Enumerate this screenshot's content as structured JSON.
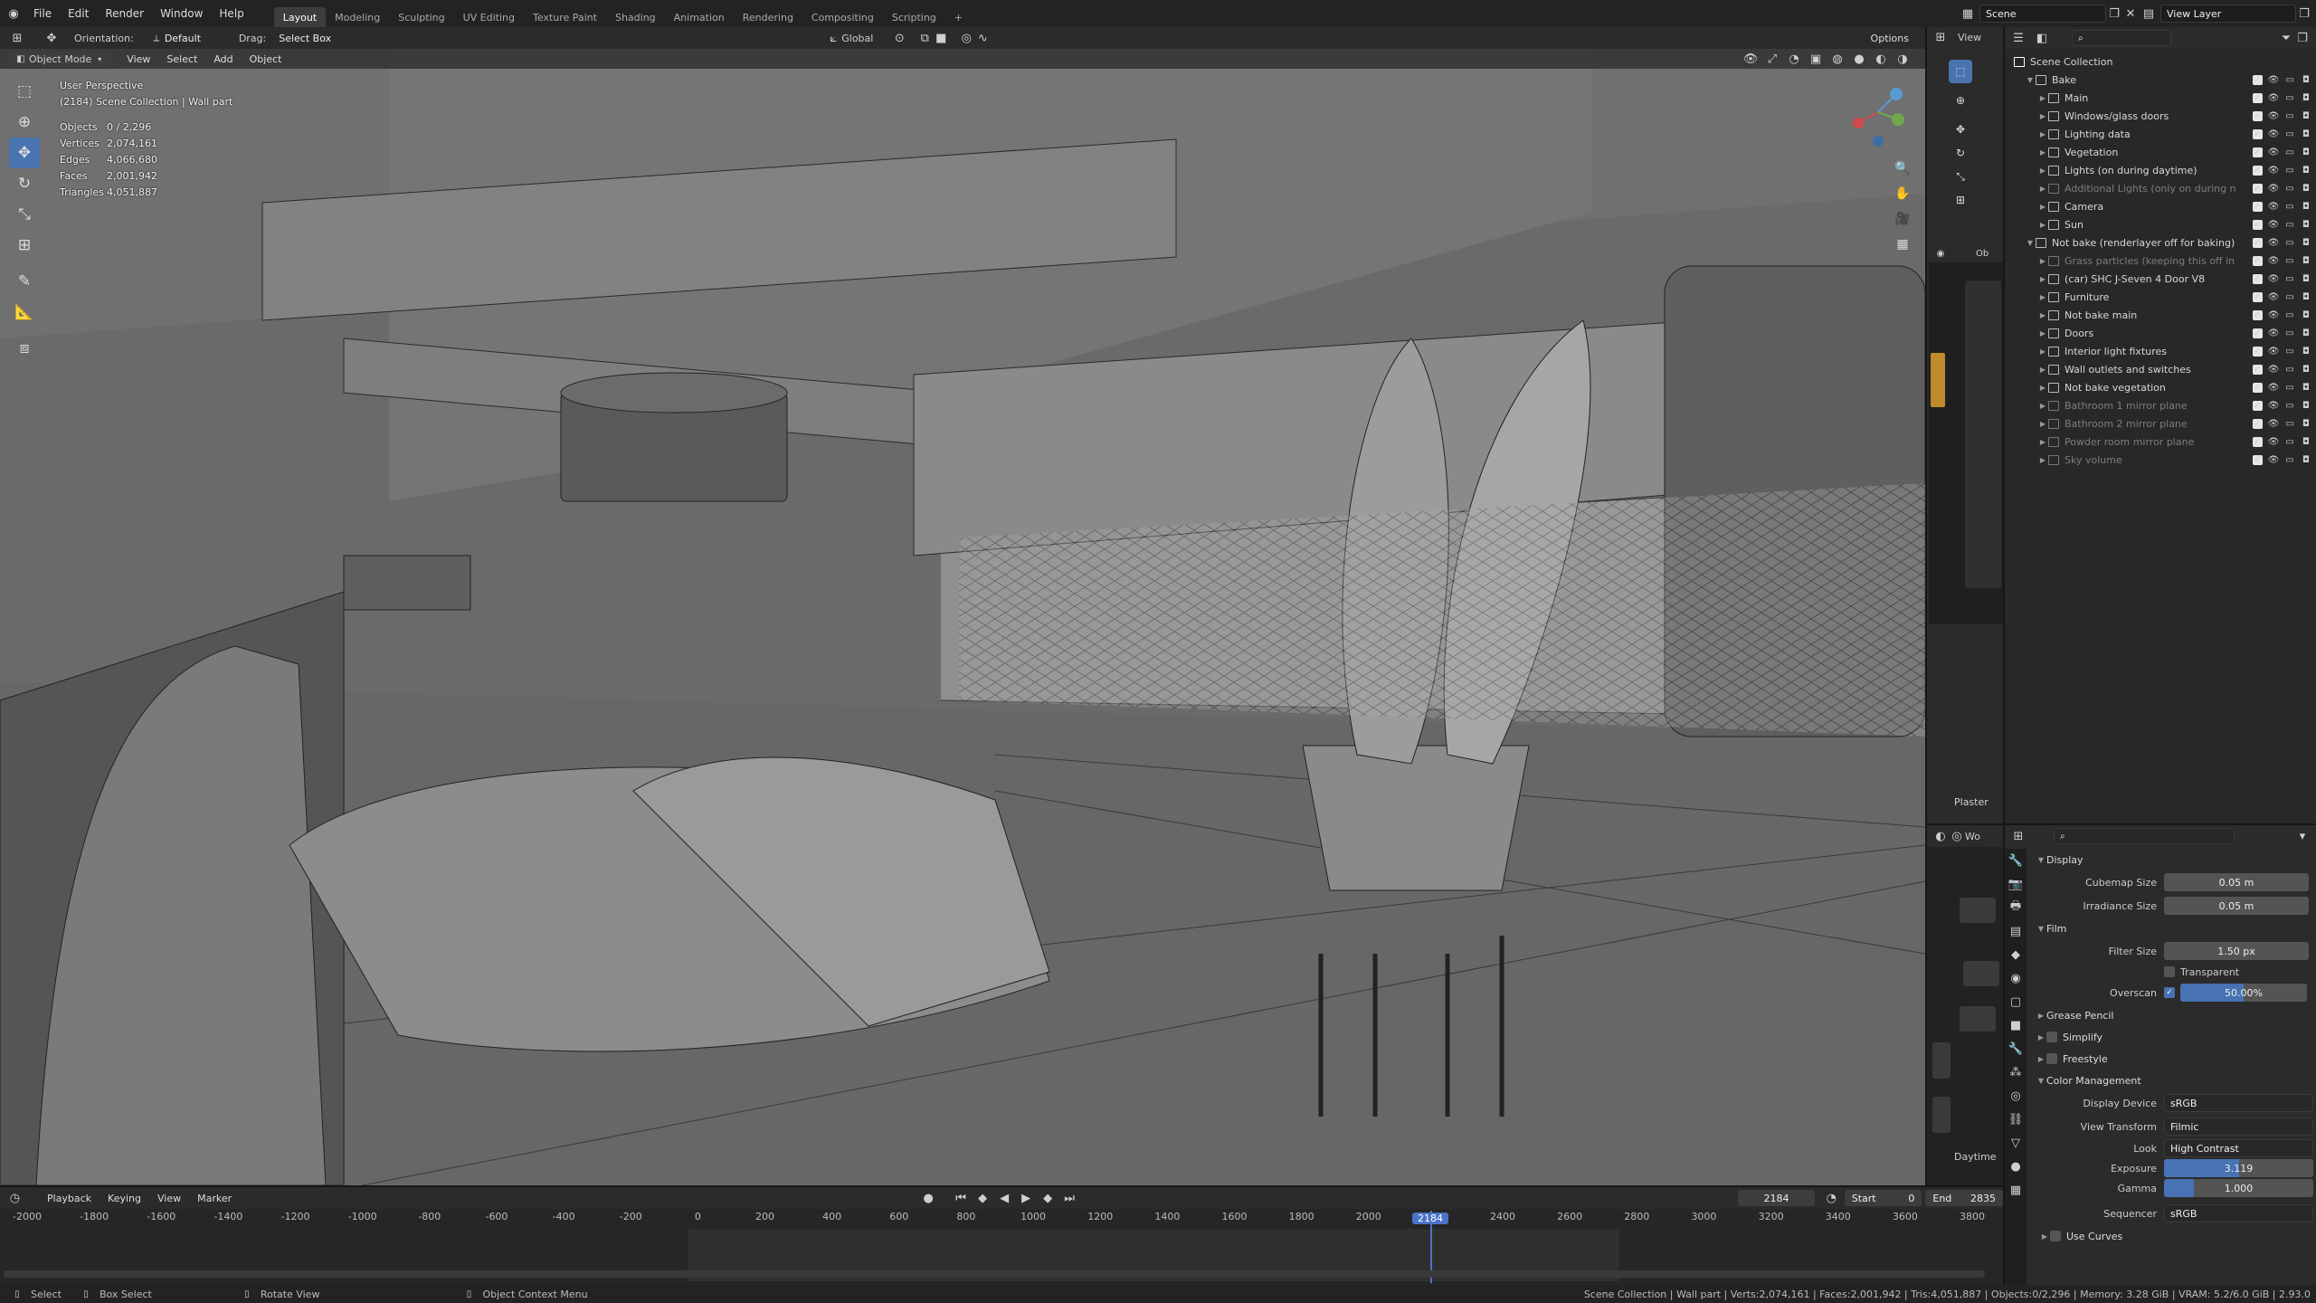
{
  "topbar": {
    "menus": [
      "File",
      "Edit",
      "Render",
      "Window",
      "Help"
    ],
    "workspaces": [
      "Layout",
      "Modeling",
      "Sculpting",
      "UV Editing",
      "Texture Paint",
      "Shading",
      "Animation",
      "Rendering",
      "Compositing",
      "Scripting"
    ],
    "active_workspace": "Layout",
    "add_tab": "+",
    "scene": "Scene",
    "view_layer": "View Layer"
  },
  "tool_settings": {
    "orientation_label": "Orientation:",
    "orientation_value": "Default",
    "drag_label": "Drag:",
    "drag_value": "Select Box",
    "transform_orientation": "Global",
    "options": "Options"
  },
  "viewport_header": {
    "mode": "Object Mode",
    "menus": [
      "View",
      "Select",
      "Add",
      "Object"
    ]
  },
  "viewport": {
    "perspective": "User Perspective",
    "collection_info": "(2184) Scene Collection | Wall part",
    "stats": [
      {
        "label": "Objects",
        "value": "0 / 2,296"
      },
      {
        "label": "Vertices",
        "value": "2,074,161"
      },
      {
        "label": "Edges",
        "value": "4,066,680"
      },
      {
        "label": "Faces",
        "value": "2,001,942"
      },
      {
        "label": "Triangles",
        "value": "4,051,887"
      }
    ]
  },
  "node_editor": {
    "view": "View",
    "material_label": "Plaster",
    "world_label": "Daytime",
    "hdr_tab": "Ob",
    "world_tab": "Wo"
  },
  "outliner": {
    "root": "Scene Collection",
    "rows": [
      {
        "name": "Bake",
        "level": 1,
        "expanded": true,
        "dim": false
      },
      {
        "name": "Main",
        "level": 2,
        "dim": false
      },
      {
        "name": "Windows/glass doors",
        "level": 2,
        "dim": false
      },
      {
        "name": "Lighting data",
        "level": 2,
        "dim": false
      },
      {
        "name": "Vegetation",
        "level": 2,
        "dim": false
      },
      {
        "name": "Lights (on during daytime)",
        "level": 2,
        "dim": false
      },
      {
        "name": "Additional Lights (only on during n",
        "level": 2,
        "dim": true
      },
      {
        "name": "Camera",
        "level": 2,
        "dim": false
      },
      {
        "name": "Sun",
        "level": 2,
        "dim": false
      },
      {
        "name": "Not bake (renderlayer off for baking)",
        "level": 1,
        "expanded": true,
        "dim": false
      },
      {
        "name": "Grass particles (keeping this off in",
        "level": 2,
        "dim": true
      },
      {
        "name": "(car) SHC J-Seven 4 Door V8",
        "level": 2,
        "dim": false
      },
      {
        "name": "Furniture",
        "level": 2,
        "dim": false
      },
      {
        "name": "Not bake main",
        "level": 2,
        "dim": false
      },
      {
        "name": "Doors",
        "level": 2,
        "dim": false
      },
      {
        "name": "Interior light fixtures",
        "level": 2,
        "dim": false
      },
      {
        "name": "Wall outlets and switches",
        "level": 2,
        "dim": false
      },
      {
        "name": "Not bake vegetation",
        "level": 2,
        "dim": false
      },
      {
        "name": "Bathroom 1 mirror plane",
        "level": 2,
        "dim": true
      },
      {
        "name": "Bathroom 2 mirror plane",
        "level": 2,
        "dim": true
      },
      {
        "name": "Powder room mirror plane",
        "level": 2,
        "dim": true
      },
      {
        "name": "Sky volume",
        "level": 2,
        "dim": true
      }
    ]
  },
  "properties": {
    "display_section": "Display",
    "cubemap_label": "Cubemap Size",
    "cubemap_value": "0.05 m",
    "irradiance_label": "Irradiance Size",
    "irradiance_value": "0.05 m",
    "film_section": "Film",
    "filter_label": "Filter Size",
    "filter_value": "1.50 px",
    "transparent_label": "Transparent",
    "overscan_label": "Overscan",
    "overscan_value": "50.00%",
    "overscan_fraction": 0.5,
    "grease_pencil": "Grease Pencil",
    "simplify": "Simplify",
    "freestyle": "Freestyle",
    "color_mgmt": "Color Management",
    "display_device_label": "Display Device",
    "display_device": "sRGB",
    "view_transform_label": "View Transform",
    "view_transform": "Filmic",
    "look_label": "Look",
    "look": "High Contrast",
    "exposure_label": "Exposure",
    "exposure": "3.119",
    "exposure_fraction": 0.5,
    "gamma_label": "Gamma",
    "gamma": "1.000",
    "gamma_fraction": 0.2,
    "sequencer_label": "Sequencer",
    "sequencer": "sRGB",
    "use_curves": "Use Curves"
  },
  "timeline": {
    "menus": [
      "Playback",
      "Keying",
      "View",
      "Marker"
    ],
    "current_frame": "2184",
    "start_label": "Start",
    "start": "0",
    "end_label": "End",
    "end": "2835",
    "ticks": [
      "-2000",
      "-1800",
      "-1600",
      "-1400",
      "-1200",
      "-1000",
      "-800",
      "-600",
      "-400",
      "-200",
      "0",
      "200",
      "400",
      "600",
      "800",
      "1000",
      "1200",
      "1400",
      "1600",
      "1800",
      "2000",
      "2200",
      "2400",
      "2600",
      "2800",
      "3000",
      "3200",
      "3400",
      "3600",
      "3800"
    ],
    "playhead": "2184"
  },
  "statusbar": {
    "select": "Select",
    "box_select": "Box Select",
    "rotate_view": "Rotate View",
    "context_menu": "Object Context Menu",
    "info": "Scene Collection | Wall part | Verts:2,074,161 | Faces:2,001,942 | Tris:4,051,887 | Objects:0/2,296 | Memory: 3.28 GiB | VRAM: 5.2/6.0 GiB | 2.93.0"
  }
}
